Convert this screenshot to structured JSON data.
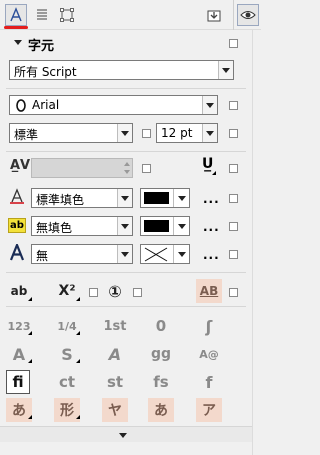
{
  "panel": {
    "section_title": "字元",
    "script_select": "所有 Script",
    "font_name": "Arial",
    "font_style": "標準",
    "font_size": "12 pt",
    "fill_type": "標準填色",
    "bg_fill_type": "無填色",
    "outline_type": "無",
    "dots": "...",
    "fill_color": "#000000"
  },
  "icons": {
    "font_icon_letter": "O",
    "char_tab_letter": "A",
    "row1": [
      "ab",
      "X²",
      "①",
      "AB"
    ],
    "row2": [
      "123",
      "1/4",
      "1st",
      "0",
      "ʃ"
    ],
    "row3": [
      "A",
      "S",
      "A",
      "gg",
      "A@"
    ],
    "row4": [
      "fi",
      "ct",
      "st",
      "fs",
      "f"
    ],
    "row5": [
      "あ",
      "形",
      "ヤ",
      "あ",
      "ア"
    ]
  }
}
